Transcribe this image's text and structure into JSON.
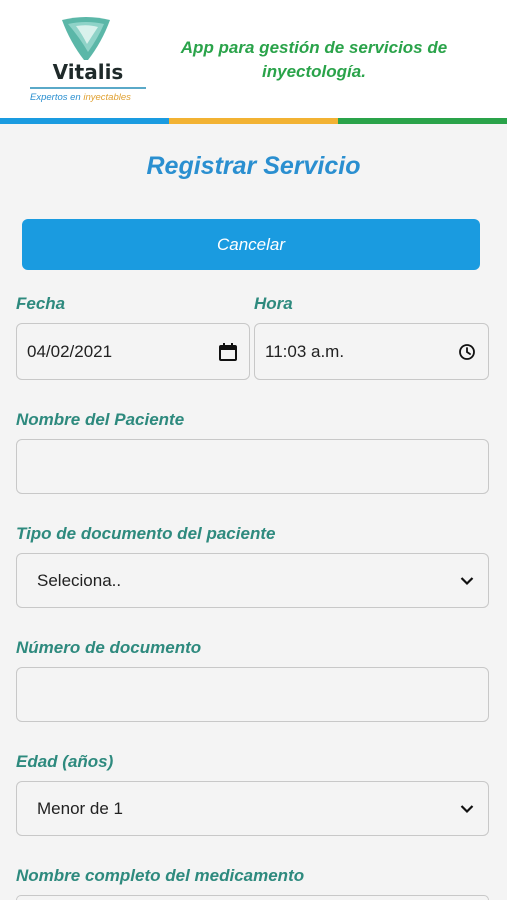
{
  "header": {
    "logo_name": "Vitalis",
    "logo_tagline_part1": "Expertos en ",
    "logo_tagline_part2": "inyectables",
    "slogan": "App para gestión de servicios de inyectología."
  },
  "colors": {
    "stripe": [
      "#1a9be0",
      "#f2b233",
      "#2aa34a"
    ],
    "primary": "#1a9be0",
    "label": "#2e8a7e",
    "title": "#2a8fd0"
  },
  "form": {
    "title": "Registrar Servicio",
    "cancel_label": "Cancelar",
    "fecha_label": "Fecha",
    "fecha_value": "04/02/2021",
    "hora_label": "Hora",
    "hora_value": "11:03 a.m.",
    "nombre_label": "Nombre del Paciente",
    "nombre_value": "",
    "tipo_doc_label": "Tipo de documento del paciente",
    "tipo_doc_value": "Seleciona..",
    "num_doc_label": "Número de documento",
    "num_doc_value": "",
    "edad_label": "Edad (años)",
    "edad_value": "Menor de 1",
    "medicamento_label": "Nombre completo del medicamento"
  },
  "icons": {
    "calendar": "calendar-icon",
    "clock": "clock-icon",
    "dropdown": "chevron-down-icon"
  }
}
